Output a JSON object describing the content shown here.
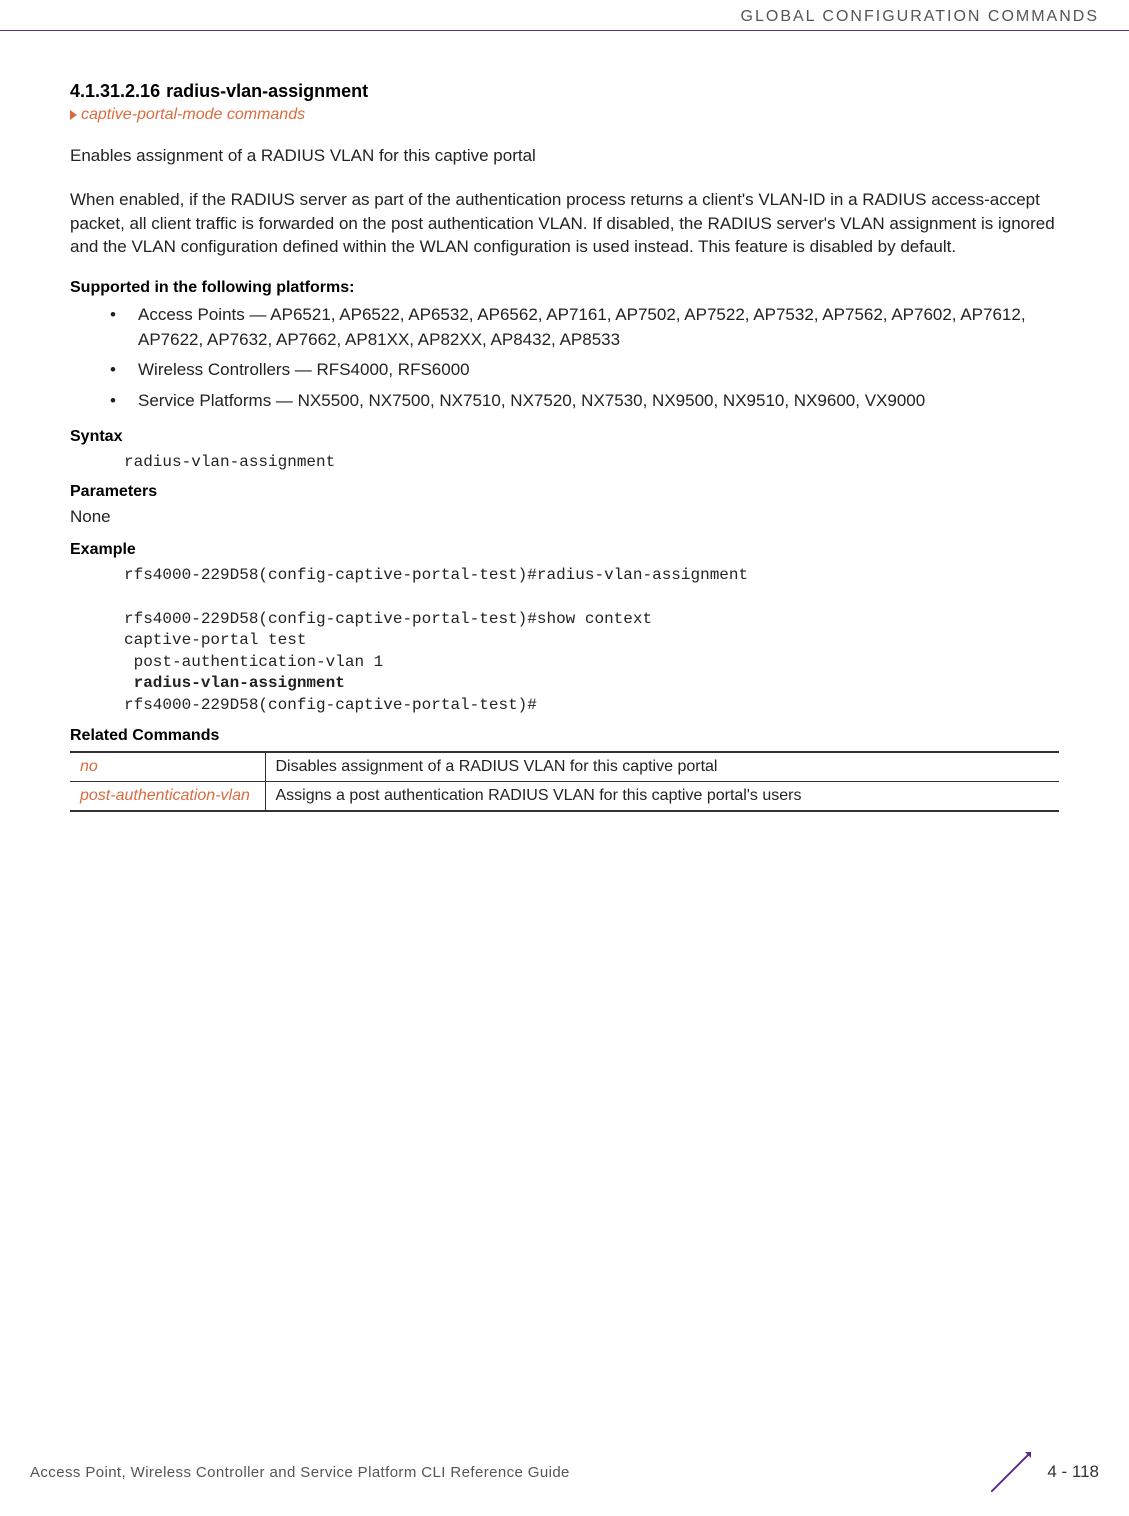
{
  "header": "GLOBAL CONFIGURATION COMMANDS",
  "section": {
    "number": "4.1.31.2.16",
    "title": "radius-vlan-assignment"
  },
  "breadcrumb": "captive-portal-mode commands",
  "para1": "Enables assignment of a RADIUS VLAN for this captive portal",
  "para2": "When enabled, if the RADIUS server as part of the authentication process returns a client's VLAN-ID in a RADIUS access-accept packet, all client traffic is forwarded on the post authentication VLAN. If disabled, the RADIUS server's VLAN assignment is ignored and the VLAN configuration defined within the WLAN configuration is used instead. This feature is disabled by default.",
  "supported_heading": "Supported in the following platforms:",
  "platforms": [
    "Access Points — AP6521, AP6522, AP6532, AP6562, AP7161, AP7502, AP7522, AP7532, AP7562, AP7602, AP7612, AP7622, AP7632, AP7662, AP81XX, AP82XX, AP8432, AP8533",
    "Wireless Controllers — RFS4000, RFS6000",
    "Service Platforms — NX5500, NX7500, NX7510, NX7520, NX7530, NX9500, NX9510, NX9600, VX9000"
  ],
  "syntax_heading": "Syntax",
  "syntax_code": "radius-vlan-assignment",
  "parameters_heading": "Parameters",
  "parameters_value": "None",
  "example_heading": "Example",
  "example_lines": {
    "l1": "rfs4000-229D58(config-captive-portal-test)#radius-vlan-assignment",
    "l2": "",
    "l3": "rfs4000-229D58(config-captive-portal-test)#show context",
    "l4": "captive-portal test",
    "l5": " post-authentication-vlan 1",
    "l6": " radius-vlan-assignment",
    "l7": "rfs4000-229D58(config-captive-portal-test)#"
  },
  "related_heading": "Related Commands",
  "related": [
    {
      "cmd": "no",
      "desc": "Disables assignment of a RADIUS VLAN for this captive portal"
    },
    {
      "cmd": "post-authentication-vlan",
      "desc": "Assigns a post authentication RADIUS VLAN for this captive portal's users"
    }
  ],
  "footer": {
    "left": "Access Point, Wireless Controller and Service Platform CLI Reference Guide",
    "page": "4 - 118"
  }
}
